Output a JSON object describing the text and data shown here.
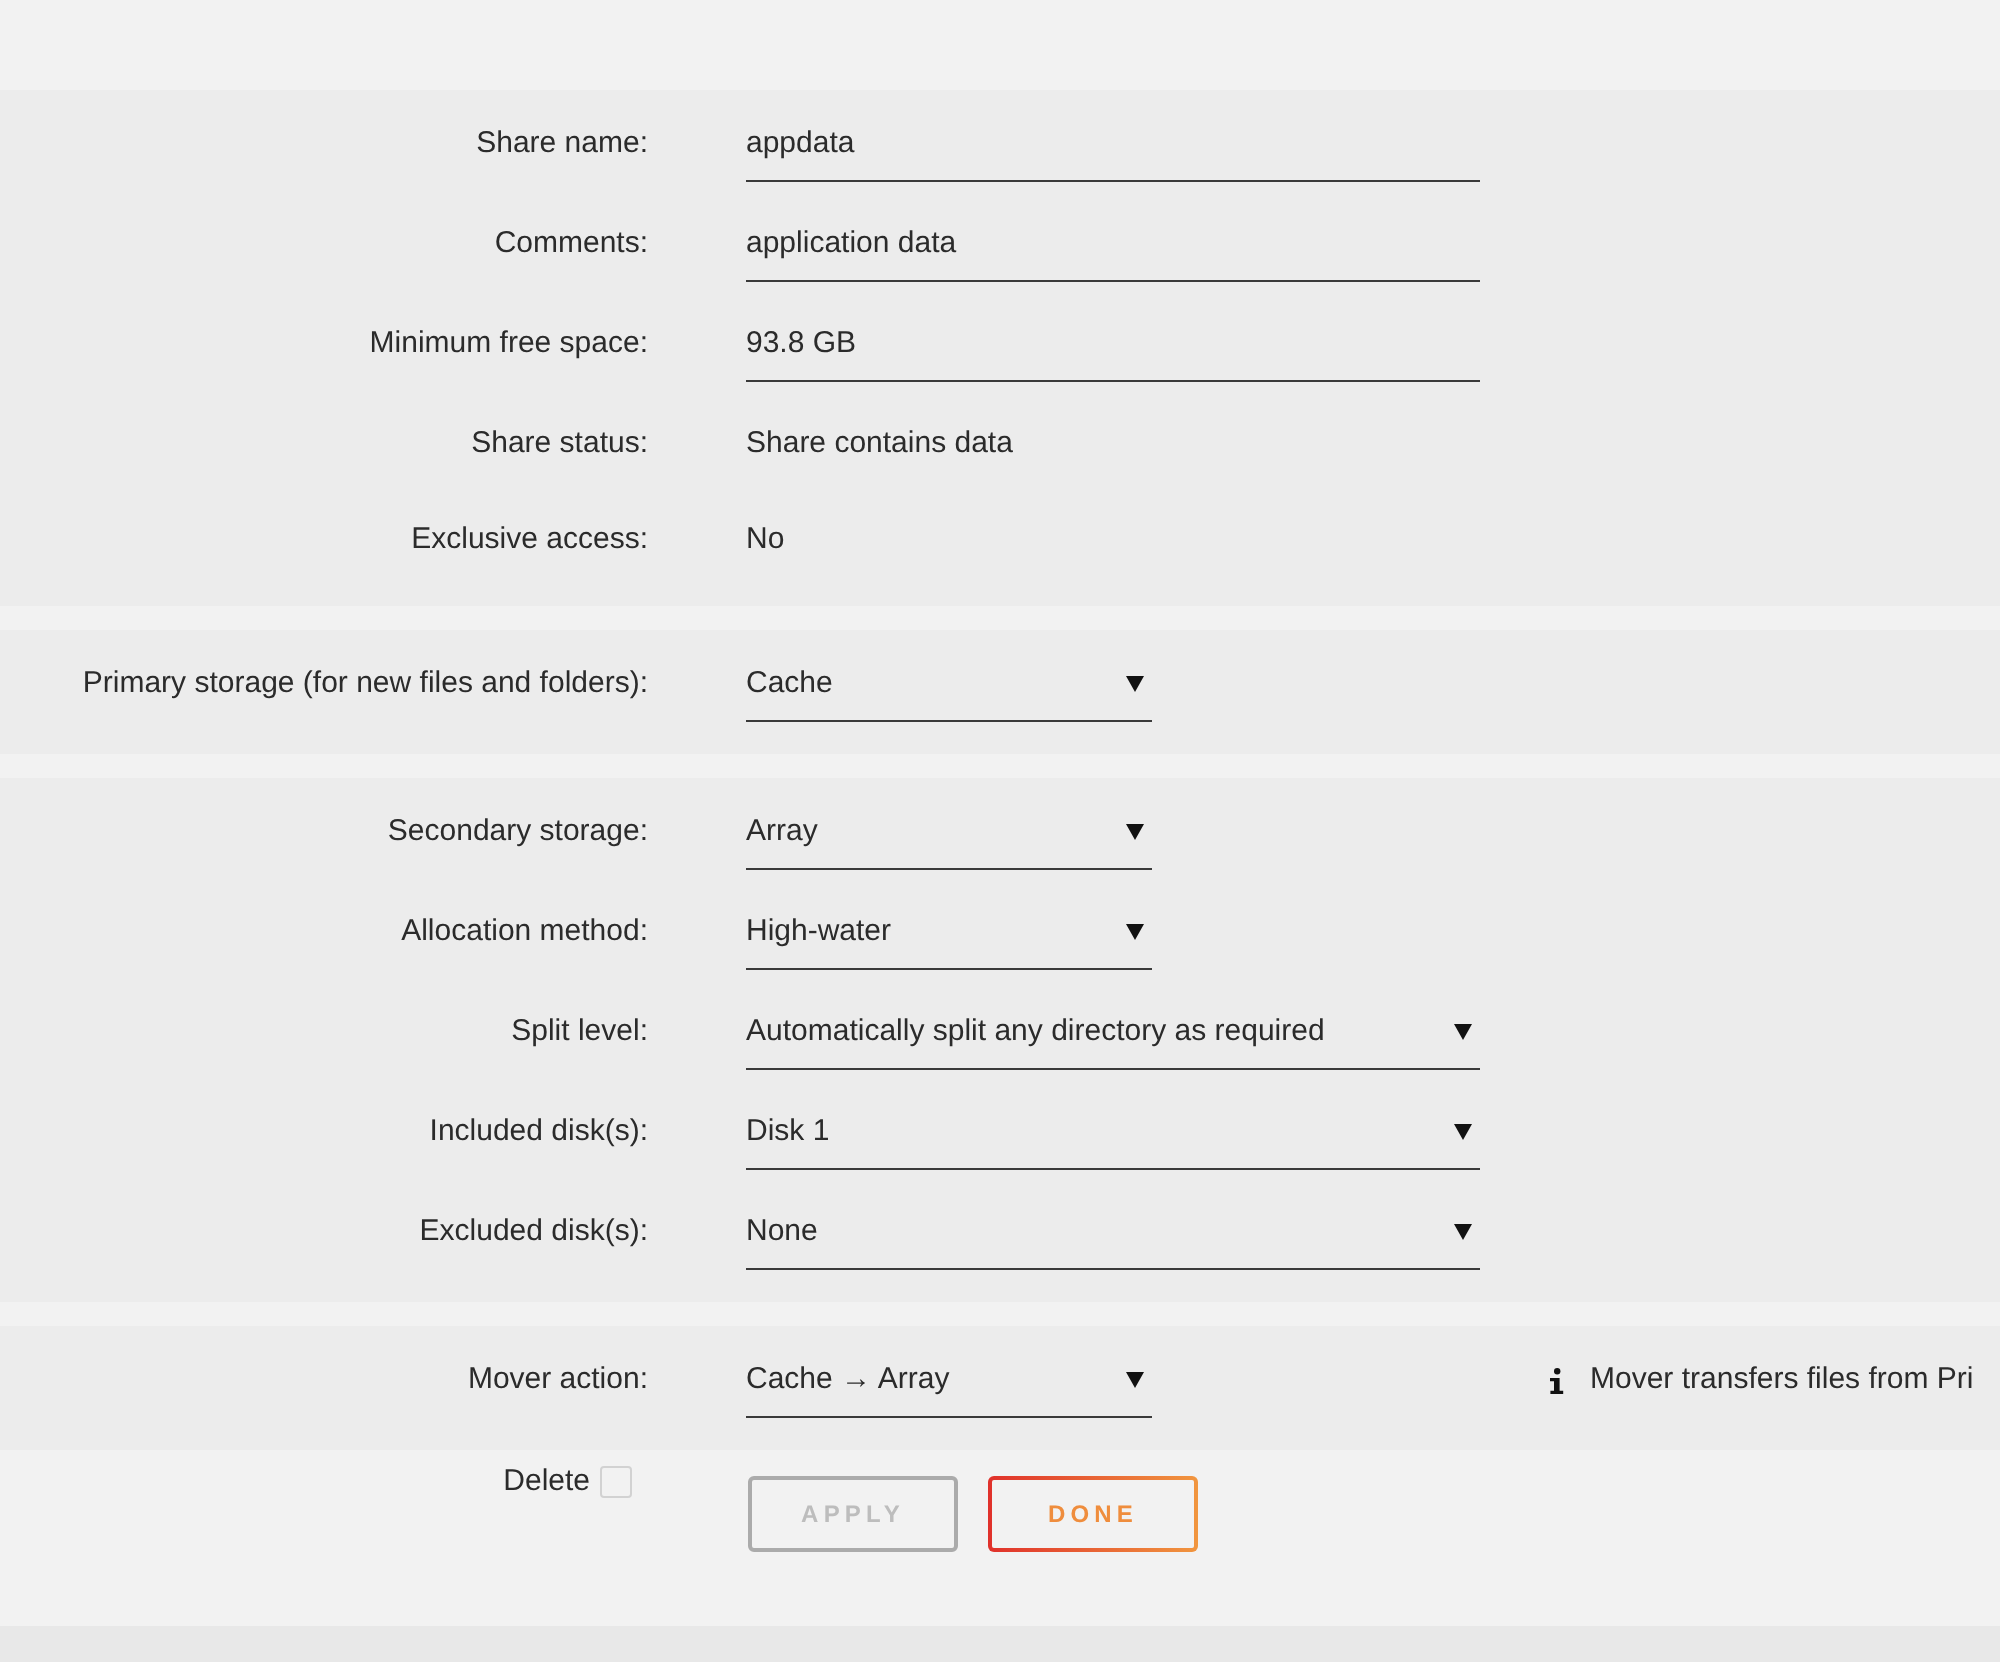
{
  "sections": [
    {
      "rows": [
        {
          "label": "Share name:",
          "kind": "input",
          "value": "appdata"
        },
        {
          "label": "Comments:",
          "kind": "input",
          "value": "application data"
        },
        {
          "label": "Minimum free space:",
          "kind": "input",
          "value": "93.8 GB"
        },
        {
          "label": "Share status:",
          "kind": "text",
          "value": "Share contains data"
        },
        {
          "label": "Exclusive access:",
          "kind": "text",
          "value": "No"
        }
      ]
    },
    {
      "rows": [
        {
          "label": "Primary storage (for new files and folders):",
          "kind": "select",
          "value": "Cache"
        }
      ]
    },
    {
      "rows": [
        {
          "label": "Secondary storage:",
          "kind": "select",
          "value": "Array"
        },
        {
          "label": "Allocation method:",
          "kind": "select",
          "value": "High-water"
        },
        {
          "label": "Split level:",
          "kind": "wideselect",
          "value": "Automatically split any directory as required"
        },
        {
          "label": "Included disk(s):",
          "kind": "wideselect",
          "value": "Disk 1"
        },
        {
          "label": "Excluded disk(s):",
          "kind": "wideselect",
          "value": "None"
        }
      ]
    },
    {
      "rows": [
        {
          "label": "Mover action:",
          "kind": "select",
          "value": "Cache → Array",
          "note": "Mover transfers files from Pri"
        }
      ]
    }
  ],
  "footer": {
    "delete": {
      "label": "Delete",
      "checked": false
    },
    "buttons": [
      {
        "label": "APPLY",
        "disabled": true
      },
      {
        "label": "DONE",
        "disabled": false
      }
    ]
  }
}
